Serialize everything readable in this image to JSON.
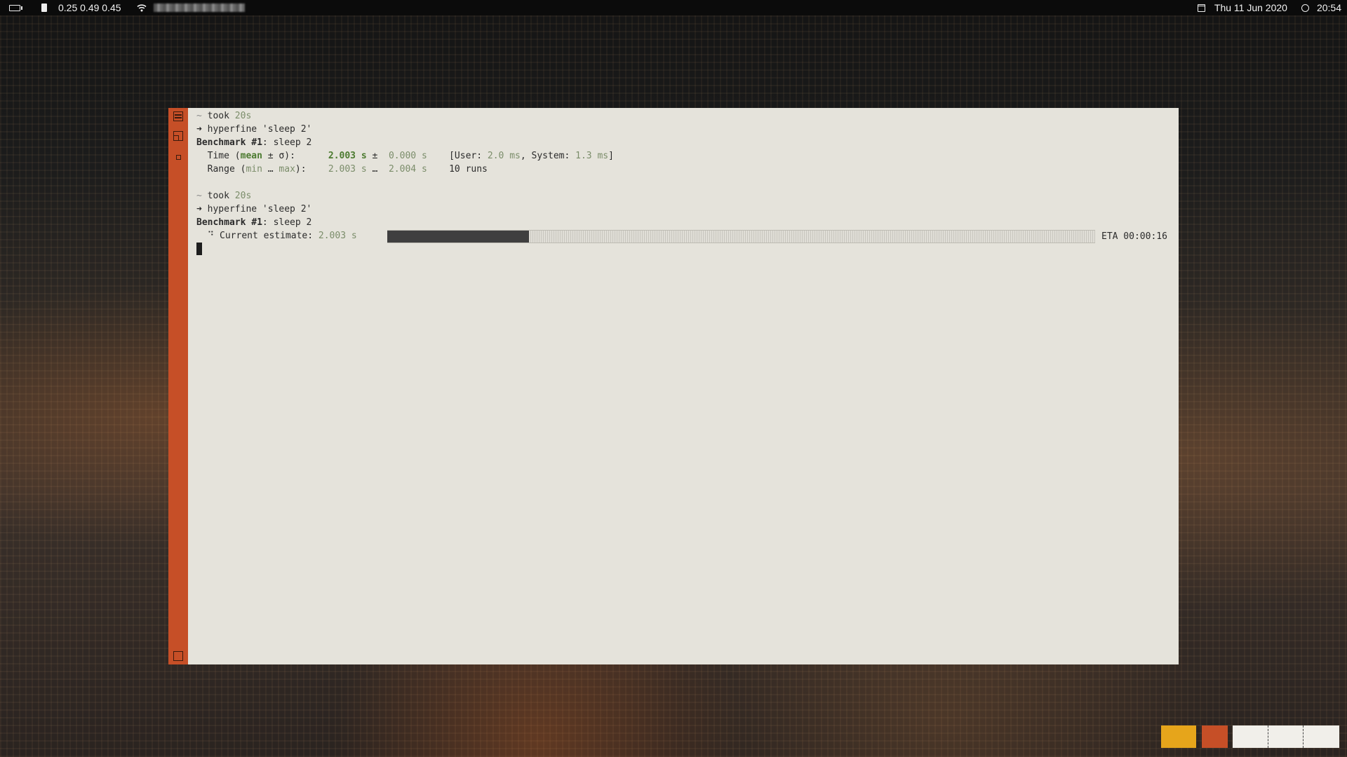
{
  "topbar": {
    "load": "0.25 0.49 0.45",
    "date": "Thu 11 Jun 2020",
    "time": "20:54",
    "icons": [
      "battery-icon",
      "sdcard-icon",
      "wifi-icon",
      "calendar-icon",
      "clock-icon"
    ]
  },
  "terminal": {
    "block1": {
      "tilde": "~",
      "took_label": "took",
      "took_value": "20s",
      "arrow": "➜",
      "command": "hyperfine 'sleep 2'",
      "bench_label": "Benchmark #1",
      "bench_name": ": sleep 2",
      "time_label": "  Time (",
      "time_mean": "mean",
      "time_pm_sigma": " ± σ",
      "time_close": "):",
      "time_value": "2.003 s",
      "time_pm": " ±",
      "time_sigma": "0.000 s",
      "user_open": "[User: ",
      "user_value": "2.0 ms",
      "system_label": ", System: ",
      "system_value": "1.3 ms",
      "user_close": "]",
      "range_label": "  Range (",
      "range_min": "min",
      "range_dots": " … ",
      "range_max": "max",
      "range_close": "):",
      "range_low": "2.003 s",
      "range_sep": " …",
      "range_high": "2.004 s",
      "runs": "10 runs"
    },
    "block2": {
      "tilde": "~",
      "took_label": "took",
      "took_value": "20s",
      "arrow": "➜",
      "command": "hyperfine 'sleep 2'",
      "bench_label": "Benchmark #1",
      "bench_name": ": sleep 2",
      "spinner": "⠙",
      "estimate_label": "Current estimate: ",
      "estimate_value": "2.003 s",
      "progress_fraction": 0.2,
      "eta": "ETA 00:00:16"
    }
  },
  "colors": {
    "sidebar": "#c64f27",
    "terminal_bg": "#e5e3db",
    "workspace_active": "#e6a51b",
    "workspace_2": "#c64f27"
  }
}
